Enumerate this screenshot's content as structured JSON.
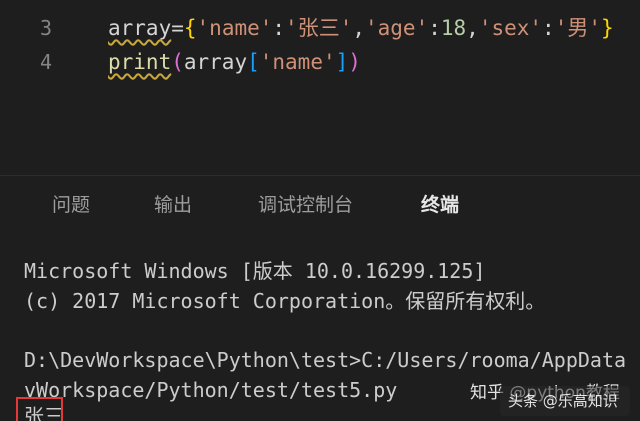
{
  "editor": {
    "lines": [
      {
        "number": "3",
        "tokens": {
          "var": "array",
          "eq": "=",
          "brace_open": "{",
          "k1": "'name'",
          "c1": ":",
          "v1": "'张三'",
          "s1": ",",
          "k2": "'age'",
          "c2": ":",
          "v2": "18",
          "s2": ",",
          "k3": "'sex'",
          "c3": ":",
          "v3": "'男'",
          "brace_close": "}"
        }
      },
      {
        "number": "4",
        "tokens": {
          "fn": "print",
          "paren_open": "(",
          "arr": "array",
          "bracket_open": "[",
          "key": "'name'",
          "bracket_close": "]",
          "paren_close": ")"
        }
      }
    ]
  },
  "panel": {
    "tabs": [
      {
        "label": "问题",
        "active": false
      },
      {
        "label": "输出",
        "active": false
      },
      {
        "label": "调试控制台",
        "active": false
      },
      {
        "label": "终端",
        "active": true
      }
    ]
  },
  "terminal": {
    "lines": [
      "Microsoft Windows [版本 10.0.16299.125]",
      "(c) 2017 Microsoft Corporation。保留所有权利。",
      "",
      "D:\\DevWorkspace\\Python\\test>C:/Users/rooma/AppData",
      "vWorkspace/Python/test/test5.py",
      "张三"
    ]
  },
  "watermark": {
    "zhihu": "知乎 @python教程",
    "toutiao": "头条 @乐高知识"
  },
  "colors": {
    "background": "#1e1e1e",
    "highlight_box": "#e03a3a",
    "string": "#ce9178",
    "number": "#b5cea8",
    "function": "#dcdcaa"
  }
}
